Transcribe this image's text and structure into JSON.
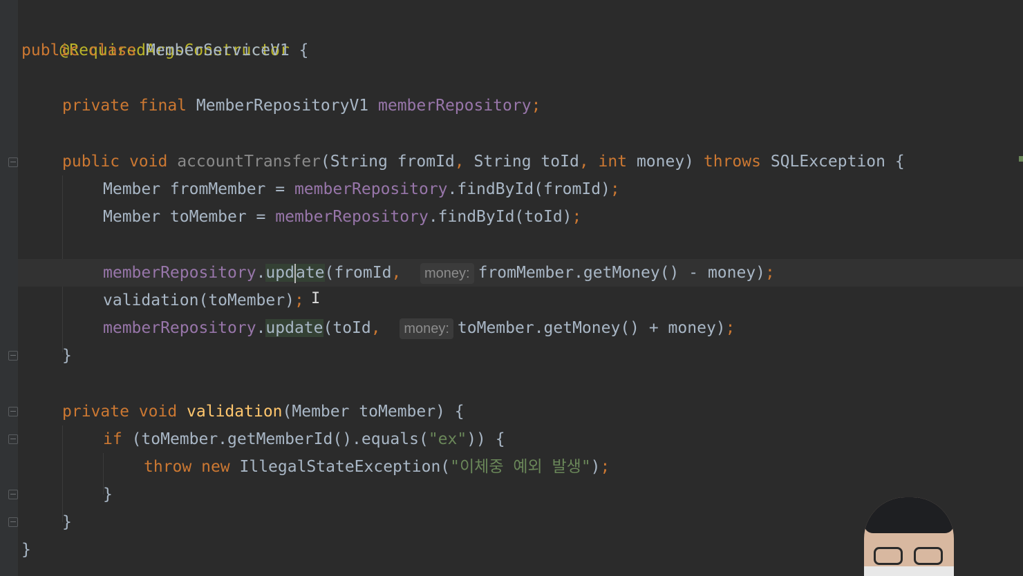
{
  "code": {
    "annotation": "@RequiredArgsConstructor",
    "kw_public": "public",
    "kw_class": "class",
    "class_name": "MemberServiceV1",
    "open_brace": " {",
    "kw_private": "private",
    "kw_final": "final",
    "repo_type": "MemberRepositoryV1",
    "repo_field": "memberRepository",
    "semicolon": ";",
    "kw_void": "void",
    "method_transfer": "accountTransfer",
    "transfer_params_a": "(String fromId",
    "comma": ",",
    "transfer_params_b": " String toId",
    "kw_int": "int",
    "transfer_params_c": " money) ",
    "kw_throws": "throws",
    "exception_clause": " SQLException {",
    "from_decl": "Member fromMember = ",
    "find_from": ".findById(fromId)",
    "to_decl": "Member toMember = ",
    "find_to": ".findById(toId)",
    "update_a": "upd",
    "update_b": "ate",
    "update_from_args": "(fromId",
    "hint_money": "money:",
    "update_from_expr": "fromMember.getMoney() - money)",
    "validation_call": "validation(toMember)",
    "update_full": "update",
    "update_to_args": "(toId",
    "update_to_expr": "toMember.getMoney() + money)",
    "close_brace": "}",
    "method_validation": "validation",
    "validation_params": "(Member toMember) {",
    "kw_if": "if",
    "if_cond": " (toMember.getMemberId().equals(",
    "str_ex": "\"ex\"",
    "if_tail": ")) {",
    "kw_throw": "throw",
    "kw_new": "new",
    "exception_ctor": " IllegalStateException(",
    "str_msg": "\"이체중 예외 발생\"",
    "paren_close": ")"
  },
  "colors": {
    "background": "#2b2b2b",
    "keyword": "#cc7832",
    "annotation": "#bbb529",
    "field": "#9876aa",
    "method": "#ffc66d",
    "string": "#6a8759",
    "text": "#a9b7c6"
  }
}
